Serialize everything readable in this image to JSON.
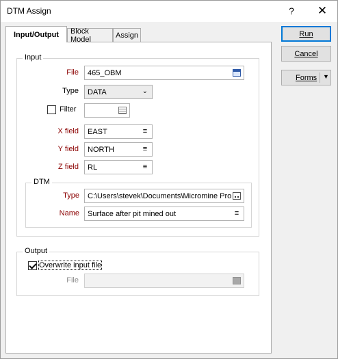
{
  "window": {
    "title": "DTM Assign",
    "help_glyph": "?",
    "close_glyph": "✕"
  },
  "tabs": [
    {
      "label": "Input/Output",
      "active": true
    },
    {
      "label": "Block Model",
      "active": false
    },
    {
      "label": "Assign",
      "active": false
    }
  ],
  "buttons": {
    "run": "Run",
    "cancel": "Cancel",
    "forms": "Forms",
    "forms_arrow": "▼"
  },
  "input": {
    "group_label": "Input",
    "file_label": "File",
    "file_value": "465_OBM",
    "type_label": "Type",
    "type_value": "DATA",
    "type_chevron": "⌄",
    "filter_label": "Filter",
    "filter_checked": false,
    "filter_value": "",
    "x_label": "X field",
    "x_value": "EAST",
    "y_label": "Y field",
    "y_value": "NORTH",
    "z_label": "Z field",
    "z_value": "RL",
    "list_glyph": "≡"
  },
  "dtm": {
    "group_label": "DTM",
    "type_label": "Type",
    "type_value": "C:\\Users\\stevek\\Documents\\Micromine Pro",
    "name_label": "Name",
    "name_value": "Surface after pit mined out"
  },
  "output": {
    "group_label": "Output",
    "overwrite_label": "Overwrite input file",
    "overwrite_checked": true,
    "file_label": "File",
    "file_value": ""
  }
}
